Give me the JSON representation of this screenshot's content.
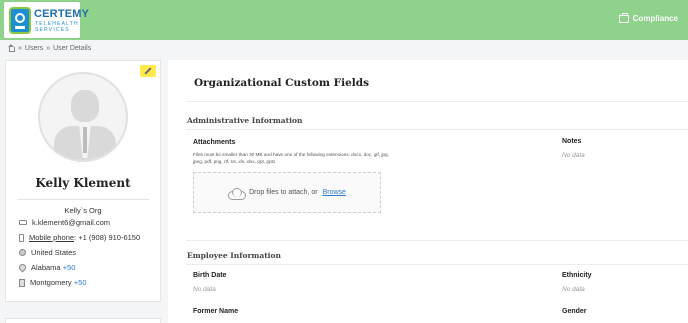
{
  "header": {
    "logo": {
      "name": "CERTEMY",
      "subtitle": "TELEHEALTH SERVICES"
    },
    "compliance_label": "Compliance",
    "brand_color": "#8ed28b"
  },
  "breadcrumb": {
    "sep": "»",
    "items": [
      "Users",
      "User Details"
    ]
  },
  "profile": {
    "name": "Kelly Klement",
    "org": "Kelly`s Org",
    "email": "k.klement6@gmail.com",
    "phone_label": "Mobile phone",
    "phone_value": ": +1 (908) 910-6150",
    "country": "United States",
    "state": "Alabama",
    "state_more": "+50",
    "city": "Montgomery",
    "city_more": "+50"
  },
  "main": {
    "title": "Organizational Custom Fields",
    "admin_section": {
      "title": "Administrative Information",
      "attachments_label": "Attachments",
      "attachments_hint": "Files must be smaller than 30 MB and have one of the following extensions: docx, doc, gif, jpg, jpeg, pdf, png, rtf, txt, xls, xlsx, ppt, pptx",
      "drop_text": "Drop files to attach, or",
      "browse_label": "Browse",
      "notes_label": "Notes",
      "notes_value": "No data"
    },
    "employee_section": {
      "title": "Employee Information",
      "birth_date_label": "Birth Date",
      "birth_date_value": "No data",
      "ethnicity_label": "Ethnicity",
      "ethnicity_value": "No data",
      "former_name_label": "Former Name",
      "gender_label": "Gender"
    }
  }
}
